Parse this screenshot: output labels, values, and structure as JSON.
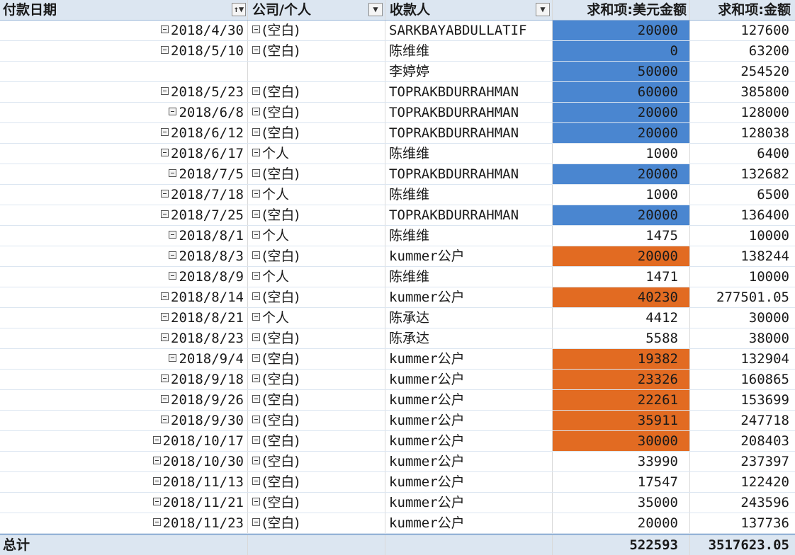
{
  "header": {
    "col_date": "付款日期",
    "col_type": "公司/个人",
    "col_payee": "收款人",
    "col_usd": "求和项:美元金额",
    "col_amount": "求和项:金额",
    "filter_icon_label": "↑▼",
    "dropdown_icon_label": "▼"
  },
  "rows": [
    {
      "date": "2018/4/30",
      "type": "(空白)",
      "payee": "SARKBAYABDULLATIF",
      "usd": "20000",
      "amount": "127600",
      "hl": "blue"
    },
    {
      "date": "2018/5/10",
      "type": "(空白)",
      "payee": "陈维维",
      "usd": "0",
      "amount": "63200",
      "hl": "blue"
    },
    {
      "date": "",
      "type": "",
      "payee": "李婷婷",
      "usd": "50000",
      "amount": "254520",
      "hl": "blue"
    },
    {
      "date": "2018/5/23",
      "type": "(空白)",
      "payee": "TOPRAKBDURRAHMAN",
      "usd": "60000",
      "amount": "385800",
      "hl": "blue"
    },
    {
      "date": "2018/6/8",
      "type": "(空白)",
      "payee": "TOPRAKBDURRAHMAN",
      "usd": "20000",
      "amount": "128000",
      "hl": "blue"
    },
    {
      "date": "2018/6/12",
      "type": "(空白)",
      "payee": "TOPRAKBDURRAHMAN",
      "usd": "20000",
      "amount": "128038",
      "hl": "blue"
    },
    {
      "date": "2018/6/17",
      "type": "个人",
      "payee": "陈维维",
      "usd": "1000",
      "amount": "6400",
      "hl": ""
    },
    {
      "date": "2018/7/5",
      "type": "(空白)",
      "payee": "TOPRAKBDURRAHMAN",
      "usd": "20000",
      "amount": "132682",
      "hl": "blue"
    },
    {
      "date": "2018/7/18",
      "type": "个人",
      "payee": "陈维维",
      "usd": "1000",
      "amount": "6500",
      "hl": ""
    },
    {
      "date": "2018/7/25",
      "type": "(空白)",
      "payee": "TOPRAKBDURRAHMAN",
      "usd": "20000",
      "amount": "136400",
      "hl": "blue"
    },
    {
      "date": "2018/8/1",
      "type": "个人",
      "payee": "陈维维",
      "usd": "1475",
      "amount": "10000",
      "hl": ""
    },
    {
      "date": "2018/8/3",
      "type": "(空白)",
      "payee": "kummer公户",
      "usd": "20000",
      "amount": "138244",
      "hl": "orange"
    },
    {
      "date": "2018/8/9",
      "type": "个人",
      "payee": "陈维维",
      "usd": "1471",
      "amount": "10000",
      "hl": ""
    },
    {
      "date": "2018/8/14",
      "type": "(空白)",
      "payee": "kummer公户",
      "usd": "40230",
      "amount": "277501.05",
      "hl": "orange"
    },
    {
      "date": "2018/8/21",
      "type": "个人",
      "payee": "陈承达",
      "usd": "4412",
      "amount": "30000",
      "hl": ""
    },
    {
      "date": "2018/8/23",
      "type": "(空白)",
      "payee": "陈承达",
      "usd": "5588",
      "amount": "38000",
      "hl": ""
    },
    {
      "date": "2018/9/4",
      "type": "(空白)",
      "payee": "kummer公户",
      "usd": "19382",
      "amount": "132904",
      "hl": "orange"
    },
    {
      "date": "2018/9/18",
      "type": "(空白)",
      "payee": "kummer公户",
      "usd": "23326",
      "amount": "160865",
      "hl": "orange"
    },
    {
      "date": "2018/9/26",
      "type": "(空白)",
      "payee": "kummer公户",
      "usd": "22261",
      "amount": "153699",
      "hl": "orange"
    },
    {
      "date": "2018/9/30",
      "type": "(空白)",
      "payee": "kummer公户",
      "usd": "35911",
      "amount": "247718",
      "hl": "orange"
    },
    {
      "date": "2018/10/17",
      "type": "(空白)",
      "payee": "kummer公户",
      "usd": "30000",
      "amount": "208403",
      "hl": "orange"
    },
    {
      "date": "2018/10/30",
      "type": "(空白)",
      "payee": "kummer公户",
      "usd": "33990",
      "amount": "237397",
      "hl": ""
    },
    {
      "date": "2018/11/13",
      "type": "(空白)",
      "payee": "kummer公户",
      "usd": "17547",
      "amount": "122420",
      "hl": ""
    },
    {
      "date": "2018/11/21",
      "type": "(空白)",
      "payee": "kummer公户",
      "usd": "35000",
      "amount": "243596",
      "hl": ""
    },
    {
      "date": "2018/11/23",
      "type": "(空白)",
      "payee": "kummer公户",
      "usd": "20000",
      "amount": "137736",
      "hl": ""
    }
  ],
  "total": {
    "label": "总计",
    "usd": "522593",
    "amount": "3517623.05"
  },
  "colors": {
    "blue_highlight": "#4a86d0",
    "orange_highlight": "#e26b22",
    "header_bg": "#dce6f1"
  }
}
